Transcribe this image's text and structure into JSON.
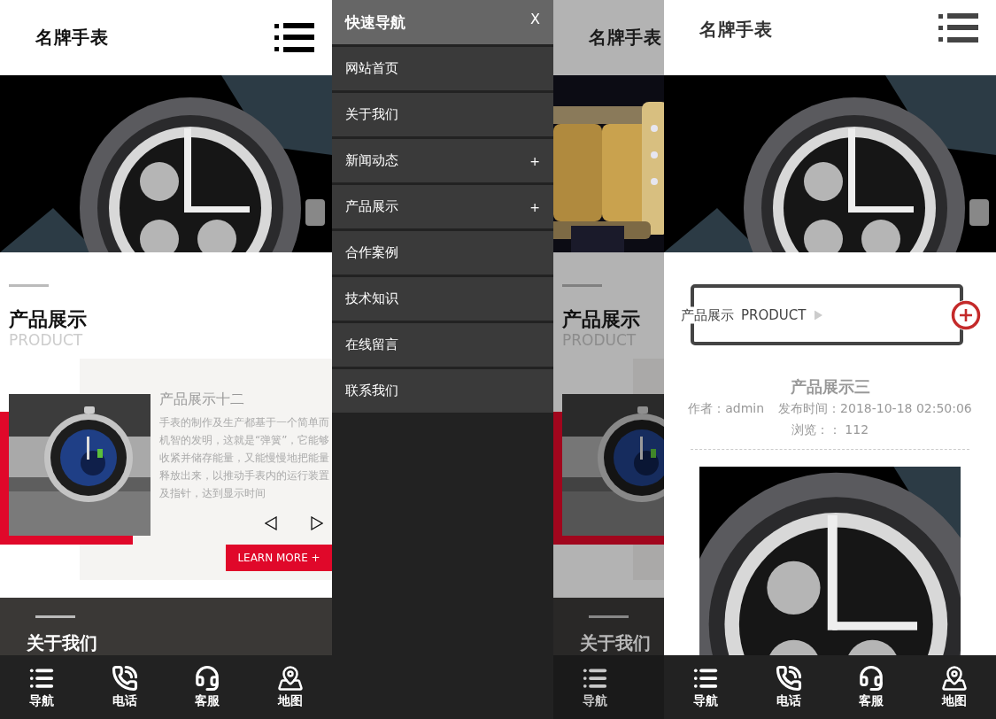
{
  "home": {
    "logo": "名牌手表",
    "product_section": {
      "title": "产品展示",
      "subtitle": "PRODUCT",
      "product": {
        "title": "产品展示十二",
        "description": "手表的制作及生产都基于一个简单而机智的发明，这就是“弹簧”，它能够收紧并储存能量，又能慢慢地把能量释放出来，以推动手表内的运行装置及指针，达到显示时间",
        "button": "LEARN MORE +"
      }
    },
    "about_section": {
      "title": "关于我们"
    },
    "bottom_nav": [
      {
        "label": "导航",
        "kind": "menu"
      },
      {
        "label": "电话",
        "kind": "phone"
      },
      {
        "label": "客服",
        "kind": "support"
      },
      {
        "label": "地图",
        "kind": "map"
      }
    ]
  },
  "menu_screen": {
    "drawer": {
      "title": "快速导航",
      "close": "X",
      "items": [
        {
          "label": "网站首页"
        },
        {
          "label": "关于我们"
        },
        {
          "label": "新闻动态",
          "toggle": "+"
        },
        {
          "label": "产品展示",
          "toggle": "+"
        },
        {
          "label": "合作案例"
        },
        {
          "label": "技术知识"
        },
        {
          "label": "在线留言"
        },
        {
          "label": "联系我们"
        }
      ]
    },
    "page_behind": {
      "logo": "名牌手表",
      "section_title": "产品展示",
      "section_subtitle": "PRODUCT",
      "about_title": "关于我们",
      "nav_label": "导航"
    }
  },
  "detail": {
    "logo": "名牌手表",
    "breadcrumb": {
      "title": "产品展示",
      "subtitle": "PRODUCT"
    },
    "article": {
      "title": "产品展示三",
      "author": "作者：admin",
      "published": "发布时间：2018-10-18 02:50:06",
      "views": "浏览：： 112"
    },
    "bottom_nav": [
      {
        "label": "导航",
        "kind": "menu"
      },
      {
        "label": "电话",
        "kind": "phone"
      },
      {
        "label": "客服",
        "kind": "support"
      },
      {
        "label": "地图",
        "kind": "map"
      }
    ]
  }
}
